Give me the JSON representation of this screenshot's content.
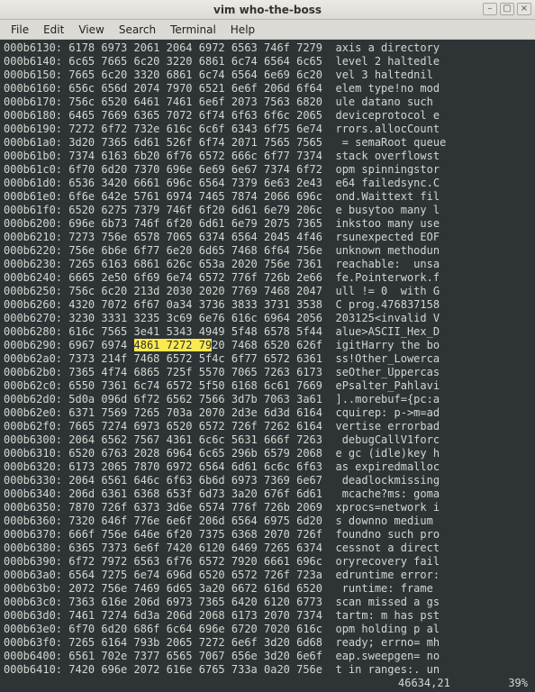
{
  "window": {
    "title": "vim who-the-boss"
  },
  "menu": {
    "file": "File",
    "edit": "Edit",
    "view": "View",
    "search": "Search",
    "terminal": "Terminal",
    "help": "Help"
  },
  "winbtn": {
    "min": "–",
    "max": "▢",
    "close": "×"
  },
  "columns_gap_hex": "  ",
  "columns_gap_asc": "  ",
  "highlight_row_index": 16,
  "highlight_hex": "4861 7272 79",
  "rows": [
    {
      "addr": "000b6130:",
      "hex": "6178 6973 2061 2064 6972 6563 746f 7279",
      "asc": "axis a directory"
    },
    {
      "addr": "000b6140:",
      "hex": "6c65 7665 6c20 3220 6861 6c74 6564 6c65",
      "asc": "level 2 haltedle"
    },
    {
      "addr": "000b6150:",
      "hex": "7665 6c20 3320 6861 6c74 6564 6e69 6c20",
      "asc": "vel 3 haltednil "
    },
    {
      "addr": "000b6160:",
      "hex": "656c 656d 2074 7970 6521 6e6f 206d 6f64",
      "asc": "elem type!no mod"
    },
    {
      "addr": "000b6170:",
      "hex": "756c 6520 6461 7461 6e6f 2073 7563 6820",
      "asc": "ule datano such "
    },
    {
      "addr": "000b6180:",
      "hex": "6465 7669 6365 7072 6f74 6f63 6f6c 2065",
      "asc": "deviceprotocol e"
    },
    {
      "addr": "000b6190:",
      "hex": "7272 6f72 732e 616c 6c6f 6343 6f75 6e74",
      "asc": "rrors.allocCount"
    },
    {
      "addr": "000b61a0:",
      "hex": "3d20 7365 6d61 526f 6f74 2071 7565 7565",
      "asc": " = semaRoot queue"
    },
    {
      "addr": "000b61b0:",
      "hex": "7374 6163 6b20 6f76 6572 666c 6f77 7374",
      "asc": "stack overflowst"
    },
    {
      "addr": "000b61c0:",
      "hex": "6f70 6d20 7370 696e 6e69 6e67 7374 6f72",
      "asc": "opm spinningstor"
    },
    {
      "addr": "000b61d0:",
      "hex": "6536 3420 6661 696c 6564 7379 6e63 2e43",
      "asc": "e64 failedsync.C"
    },
    {
      "addr": "000b61e0:",
      "hex": "6f6e 642e 5761 6974 7465 7874 2066 696c",
      "asc": "ond.Waittext fil"
    },
    {
      "addr": "000b61f0:",
      "hex": "6520 6275 7379 746f 6f20 6d61 6e79 206c",
      "asc": "e busytoo many l"
    },
    {
      "addr": "000b6200:",
      "hex": "696e 6b73 746f 6f20 6d61 6e79 2075 7365",
      "asc": "inkstoo many use"
    },
    {
      "addr": "000b6210:",
      "hex": "7273 756e 6578 7065 6374 6564 2045 4f46",
      "asc": "rsunexpected EOF"
    },
    {
      "addr": "000b6220:",
      "hex": "756e 6b6e 6f77 6e20 6d65 7468 6f64 756e",
      "asc": "unknown methodun"
    },
    {
      "addr": "000b6230:",
      "hex": "7265 6163 6861 626c 653a 2020 756e 7361",
      "asc": "reachable:  unsa"
    },
    {
      "addr": "000b6240:",
      "hex": "6665 2e50 6f69 6e74 6572 776f 726b 2e66",
      "asc": "fe.Pointerwork.f"
    },
    {
      "addr": "000b6250:",
      "hex": "756c 6c20 213d 2030 2020 7769 7468 2047",
      "asc": "ull != 0  with G"
    },
    {
      "addr": "000b6260:",
      "hex": "4320 7072 6f67 0a34 3736 3833 3731 3538",
      "asc": "C prog.476837158"
    },
    {
      "addr": "000b6270:",
      "hex": "3230 3331 3235 3c69 6e76 616c 6964 2056",
      "asc": "203125<invalid V"
    },
    {
      "addr": "000b6280:",
      "hex": "616c 7565 3e41 5343 4949 5f48 6578 5f44",
      "asc": "alue>ASCII_Hex_D"
    },
    {
      "addr": "000b6290:",
      "hex": "6967 6974 4861 7272 7920 7468 6520 626f",
      "asc": "igitHarry the bo"
    },
    {
      "addr": "000b62a0:",
      "hex": "7373 214f 7468 6572 5f4c 6f77 6572 6361",
      "asc": "ss!Other_Lowerca"
    },
    {
      "addr": "000b62b0:",
      "hex": "7365 4f74 6865 725f 5570 7065 7263 6173",
      "asc": "seOther_Uppercas"
    },
    {
      "addr": "000b62c0:",
      "hex": "6550 7361 6c74 6572 5f50 6168 6c61 7669",
      "asc": "ePsalter_Pahlavi"
    },
    {
      "addr": "000b62d0:",
      "hex": "5d0a 096d 6f72 6562 7566 3d7b 7063 3a61",
      "asc": "]..morebuf={pc:a"
    },
    {
      "addr": "000b62e0:",
      "hex": "6371 7569 7265 703a 2070 2d3e 6d3d 6164",
      "asc": "cquirep: p->m=ad"
    },
    {
      "addr": "000b62f0:",
      "hex": "7665 7274 6973 6520 6572 726f 7262 6164",
      "asc": "vertise errorbad"
    },
    {
      "addr": "000b6300:",
      "hex": "2064 6562 7567 4361 6c6c 5631 666f 7263",
      "asc": " debugCallV1forc"
    },
    {
      "addr": "000b6310:",
      "hex": "6520 6763 2028 6964 6c65 296b 6579 2068",
      "asc": "e gc (idle)key h"
    },
    {
      "addr": "000b6320:",
      "hex": "6173 2065 7870 6972 6564 6d61 6c6c 6f63",
      "asc": "as expiredmalloc"
    },
    {
      "addr": "000b6330:",
      "hex": "2064 6561 646c 6f63 6b6d 6973 7369 6e67",
      "asc": " deadlockmissing"
    },
    {
      "addr": "000b6340:",
      "hex": "206d 6361 6368 653f 6d73 3a20 676f 6d61",
      "asc": " mcache?ms: goma"
    },
    {
      "addr": "000b6350:",
      "hex": "7870 726f 6373 3d6e 6574 776f 726b 2069",
      "asc": "xprocs=network i"
    },
    {
      "addr": "000b6360:",
      "hex": "7320 646f 776e 6e6f 206d 6564 6975 6d20",
      "asc": "s downno medium "
    },
    {
      "addr": "000b6370:",
      "hex": "666f 756e 646e 6f20 7375 6368 2070 726f",
      "asc": "foundno such pro"
    },
    {
      "addr": "000b6380:",
      "hex": "6365 7373 6e6f 7420 6120 6469 7265 6374",
      "asc": "cessnot a direct"
    },
    {
      "addr": "000b6390:",
      "hex": "6f72 7972 6563 6f76 6572 7920 6661 696c",
      "asc": "oryrecovery fail"
    },
    {
      "addr": "000b63a0:",
      "hex": "6564 7275 6e74 696d 6520 6572 726f 723a",
      "asc": "edruntime error:"
    },
    {
      "addr": "000b63b0:",
      "hex": "2072 756e 7469 6d65 3a20 6672 616d 6520",
      "asc": " runtime: frame "
    },
    {
      "addr": "000b63c0:",
      "hex": "7363 616e 206d 6973 7365 6420 6120 6773",
      "asc": "scan missed a gs"
    },
    {
      "addr": "000b63d0:",
      "hex": "7461 7274 6d3a 206d 2068 6173 2070 7374",
      "asc": "tartm: m has pst"
    },
    {
      "addr": "000b63e0:",
      "hex": "6f70 6d20 686f 6c64 696e 6720 7020 616c",
      "asc": "opm holding p al"
    },
    {
      "addr": "000b63f0:",
      "hex": "7265 6164 793b 2065 7272 6e6f 3d20 6d68",
      "asc": "ready; errno= mh"
    },
    {
      "addr": "000b6400:",
      "hex": "6561 702e 7377 6565 7067 656e 3d20 6e6f",
      "asc": "eap.sweepgen= no"
    },
    {
      "addr": "000b6410:",
      "hex": "7420 696e 2072 616e 6765 733a 0a20 756e",
      "asc": "t in ranges:. un"
    }
  ],
  "status": {
    "pos": "46634,21",
    "pct": "39%"
  }
}
